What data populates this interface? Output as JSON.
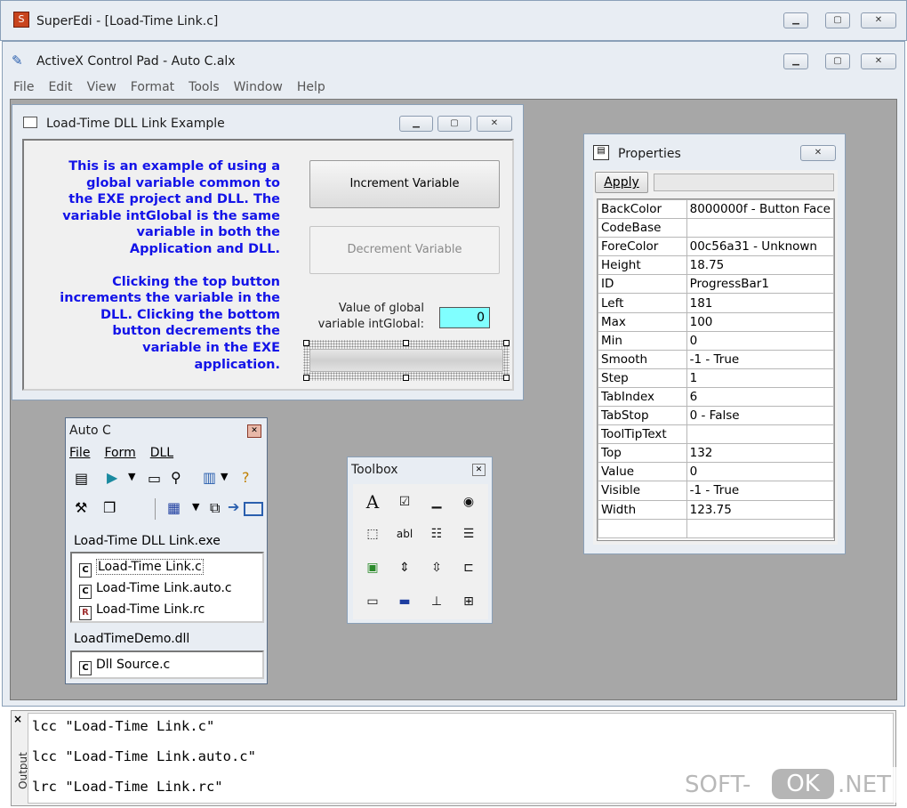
{
  "superedi": {
    "title": "SuperEdi - [Load-Time Link.c]"
  },
  "main_window": {
    "title": "ActiveX Control Pad - Auto C.alx",
    "menu": [
      "File",
      "Edit",
      "View",
      "Format",
      "Tools",
      "Window",
      "Help"
    ]
  },
  "form_window": {
    "title": "Load-Time DLL Link Example",
    "description_1": [
      "This is an example of using a",
      "global variable common to",
      "the EXE project and DLL. The",
      "variable intGlobal is the same",
      "variable in both the",
      "Application and DLL."
    ],
    "description_2": [
      "Clicking the top button",
      "increments the variable in the",
      "DLL. Clicking the bottom",
      "button decrements the",
      "variable in the EXE",
      "application."
    ],
    "increment_label": "Increment Variable",
    "decrement_label": "Decrement Variable",
    "value_label_1": "Value of global",
    "value_label_2": "variable intGlobal:",
    "value": "0"
  },
  "properties": {
    "title": "Properties",
    "apply_label": "Apply",
    "rows": [
      [
        "BackColor",
        "8000000f - Button Face"
      ],
      [
        "CodeBase",
        ""
      ],
      [
        "ForeColor",
        "00c56a31 - Unknown"
      ],
      [
        "Height",
        "18.75"
      ],
      [
        "ID",
        "ProgressBar1"
      ],
      [
        "Left",
        "181"
      ],
      [
        "Max",
        "100"
      ],
      [
        "Min",
        "0"
      ],
      [
        "Smooth",
        "-1 - True"
      ],
      [
        "Step",
        "1"
      ],
      [
        "TabIndex",
        "6"
      ],
      [
        "TabStop",
        "0 - False"
      ],
      [
        "ToolTipText",
        ""
      ],
      [
        "Top",
        "132"
      ],
      [
        "Value",
        "0"
      ],
      [
        "Visible",
        "-1 - True"
      ],
      [
        "Width",
        "123.75"
      ]
    ]
  },
  "project_window": {
    "title": "Auto C",
    "menu": [
      "File",
      "Form",
      "DLL"
    ],
    "exe_group": "Load-Time DLL Link.exe",
    "exe_files": [
      "Load-Time Link.c",
      "Load-Time Link.auto.c",
      "Load-Time Link.rc"
    ],
    "dll_group": "LoadTimeDemo.dll",
    "dll_files": [
      "Dll Source.c"
    ]
  },
  "toolbox": {
    "title": "Toolbox"
  },
  "output": {
    "tab_label": "Output",
    "lines": [
      "lcc \"Load-Time Link.c\"",
      "lcc \"Load-Time Link.auto.c\"",
      "lrc \"Load-Time Link.rc\""
    ]
  },
  "watermark": {
    "left": "SOFT-",
    "badge": "OK",
    "right": ".NET"
  },
  "colors": {
    "form_text": "#1313e8",
    "value_box": "#80ffff",
    "workspace": "#a7a7a7"
  }
}
